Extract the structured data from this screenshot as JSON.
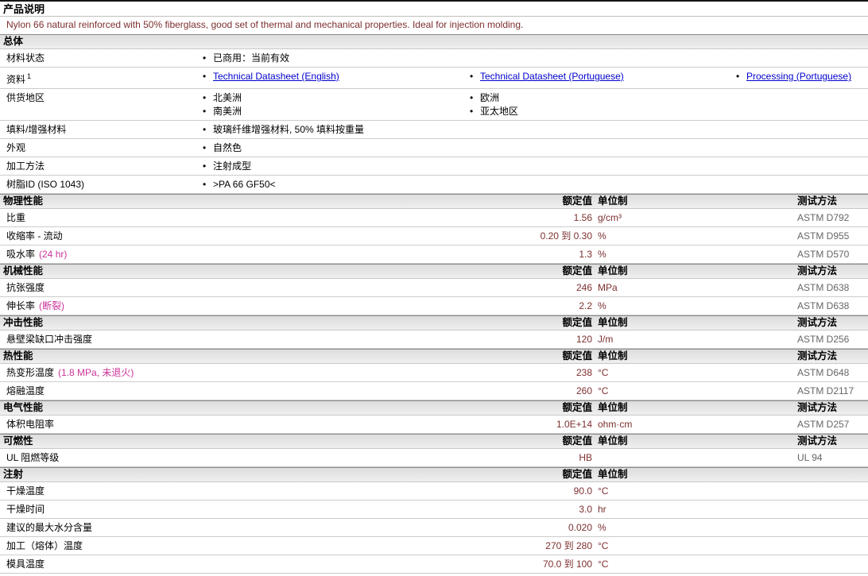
{
  "page": {
    "title": "产品说明",
    "description": "Nylon 66 natural reinforced with 50% fiberglass, good set of thermal and mechanical properties. Ideal for injection molding."
  },
  "icons": {
    "bullet": "•"
  },
  "colors": {
    "value_text": "#7d2f2f",
    "condition_text": "#cc3399",
    "method_text": "#666666",
    "link_text": "#0000cc",
    "header_bar": "#dddddd"
  },
  "general": {
    "header": "总体",
    "rows": [
      {
        "label": "材料状态",
        "col1": [
          "已商用：当前有效"
        ]
      },
      {
        "label": "资料",
        "sup": "1",
        "links": [
          "Technical Datasheet (English)",
          "Technical Datasheet (Portuguese)",
          "Processing (Portuguese)"
        ]
      },
      {
        "label": "供货地区",
        "col1": [
          "北美洲",
          "南美洲"
        ],
        "col2": [
          "欧洲",
          "亚太地区"
        ]
      },
      {
        "label": "填料/增强材料",
        "col1": [
          "玻璃纤维增强材料, 50% 填料按重量"
        ]
      },
      {
        "label": "外观",
        "col1": [
          "自然色"
        ]
      },
      {
        "label": "加工方法",
        "col1": [
          "注射成型"
        ]
      },
      {
        "label": "树脂ID (ISO 1043)",
        "col1": [
          ">PA 66 GF50<"
        ]
      }
    ]
  },
  "table_headers": {
    "value": "额定值",
    "unit": "单位制",
    "method": "测试方法"
  },
  "sections": [
    {
      "name": "物理性能",
      "rows": [
        {
          "label": "比重",
          "value": "1.56",
          "unit": "g/cm³",
          "method": "ASTM D792"
        },
        {
          "label": "收缩率 - 流动",
          "value": "0.20 到 0.30",
          "unit": "%",
          "method": "ASTM D955"
        },
        {
          "label": "吸水率",
          "condition": "(24 hr)",
          "value": "1.3",
          "unit": "%",
          "method": "ASTM D570"
        }
      ]
    },
    {
      "name": "机械性能",
      "rows": [
        {
          "label": "抗张强度",
          "value": "246",
          "unit": "MPa",
          "method": "ASTM D638"
        },
        {
          "label": "伸长率",
          "condition": "(断裂)",
          "value": "2.2",
          "unit": "%",
          "method": "ASTM D638"
        }
      ]
    },
    {
      "name": "冲击性能",
      "rows": [
        {
          "label": "悬壁梁缺口冲击强度",
          "value": "120",
          "unit": "J/m",
          "method": "ASTM D256"
        }
      ]
    },
    {
      "name": "热性能",
      "rows": [
        {
          "label": "热变形温度",
          "condition": "(1.8 MPa, 未退火)",
          "value": "238",
          "unit": "°C",
          "method": "ASTM D648"
        },
        {
          "label": "熔融温度",
          "value": "260",
          "unit": "°C",
          "method": "ASTM D2117"
        }
      ]
    },
    {
      "name": "电气性能",
      "rows": [
        {
          "label": "体积电阻率",
          "value": "1.0E+14",
          "unit": "ohm·cm",
          "method": "ASTM D257"
        }
      ]
    },
    {
      "name": "可燃性",
      "rows": [
        {
          "label": "UL 阻燃等级",
          "value": "HB",
          "unit": "",
          "method": "UL 94"
        }
      ]
    },
    {
      "name": "注射",
      "rows": [
        {
          "label": "干燥温度",
          "value": "90.0",
          "unit": "°C"
        },
        {
          "label": "干燥时间",
          "value": "3.0",
          "unit": "hr"
        },
        {
          "label": "建议的最大水分含量",
          "value": "0.020",
          "unit": "%"
        },
        {
          "label": "加工（熔体）温度",
          "value": "270 到 280",
          "unit": "°C"
        },
        {
          "label": "模具温度",
          "value": "70.0 到 100",
          "unit": "°C"
        }
      ]
    }
  ]
}
